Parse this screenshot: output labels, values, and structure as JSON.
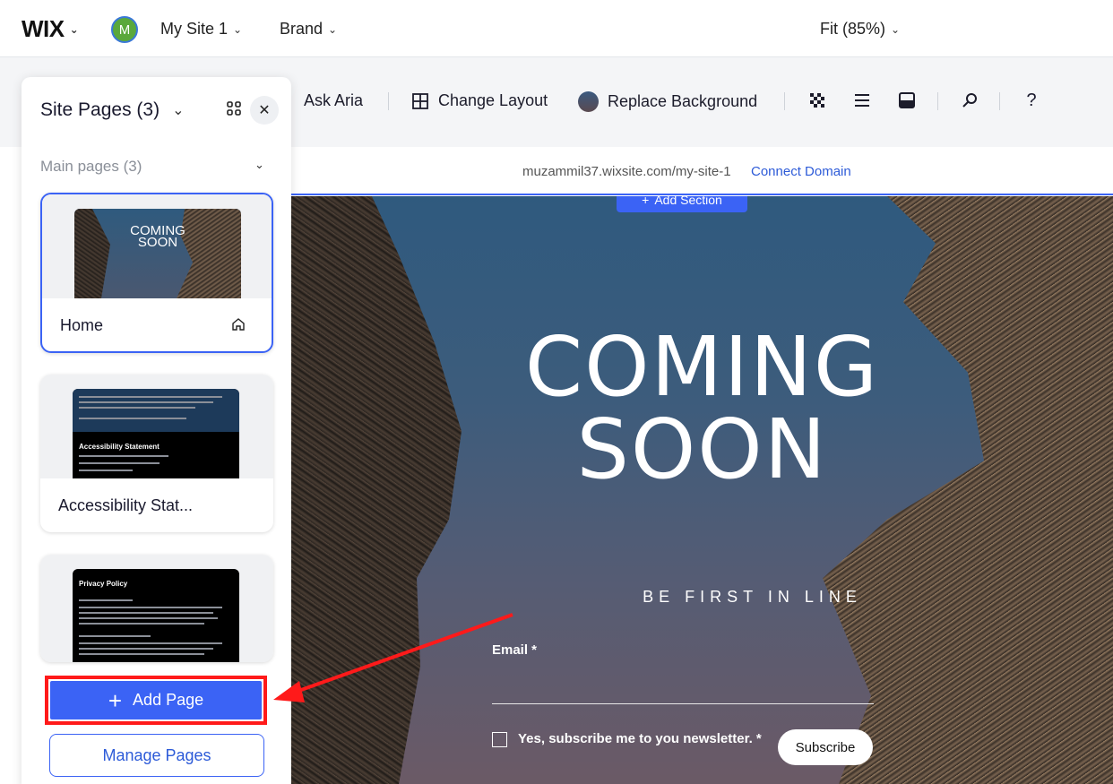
{
  "topbar": {
    "logo": "WIX",
    "avatar_letter": "M",
    "site_menu": "My Site 1",
    "brand_menu": "Brand",
    "zoom": "Fit (85%)"
  },
  "toolbar": {
    "ask_aria": "Ask Aria",
    "change_layout": "Change Layout",
    "replace_background": "Replace Background",
    "help": "?"
  },
  "urlbar": {
    "url": "muzammil37.wixsite.com/my-site-1",
    "connect_domain": "Connect Domain"
  },
  "canvas": {
    "add_section": "Add Section",
    "headline_line1": "COMING",
    "headline_line2": "SOON",
    "tagline": "BE FIRST IN LINE",
    "email_label": "Email *",
    "newsletter_label": "Yes, subscribe me to you newsletter. *",
    "subscribe_button": "Subscribe"
  },
  "panel": {
    "title": "Site Pages (3)",
    "section_label": "Main pages (3)",
    "pages": [
      {
        "label": "Home",
        "thumb_text_1": "COMING",
        "thumb_text_2": "SOON"
      },
      {
        "label": "Accessibility Stat...",
        "thumb_title": "Accessibility Statement"
      },
      {
        "label": "",
        "thumb_title": "Privacy Policy"
      }
    ],
    "add_page": "Add Page",
    "manage_pages": "Manage Pages"
  },
  "colors": {
    "accent": "#3b63f5",
    "highlight": "#ff1a1a"
  }
}
